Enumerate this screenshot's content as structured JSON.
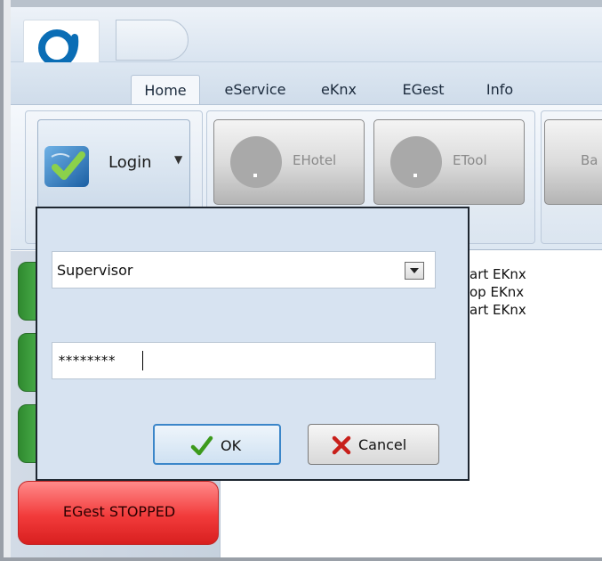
{
  "ribbon": {
    "tabs": [
      {
        "label": "Home",
        "active": true
      },
      {
        "label": "eService",
        "active": false
      },
      {
        "label": "eKnx",
        "active": false
      },
      {
        "label": "EGest",
        "active": false
      },
      {
        "label": "Info",
        "active": false
      }
    ],
    "login_label": "Login",
    "buttons": [
      {
        "label": "EHotel"
      },
      {
        "label": "ETool"
      },
      {
        "label": "Ba"
      }
    ]
  },
  "log": {
    "lines": [
      "art EKnx",
      "op EKnx",
      "art EKnx"
    ]
  },
  "status": {
    "egest_label": "EGest STOPPED",
    "egest_color": "#f23b3b",
    "running_color": "#3fae3f"
  },
  "dialog": {
    "user_selected": "Supervisor",
    "password_value": "********",
    "ok_label": "OK",
    "cancel_label": "Cancel"
  },
  "colors": {
    "ribbon_blue": "#d9e4f0",
    "logo_blue": "#0a6db5",
    "ok_check": "#3c9a1c",
    "cancel_x": "#c8201b"
  }
}
